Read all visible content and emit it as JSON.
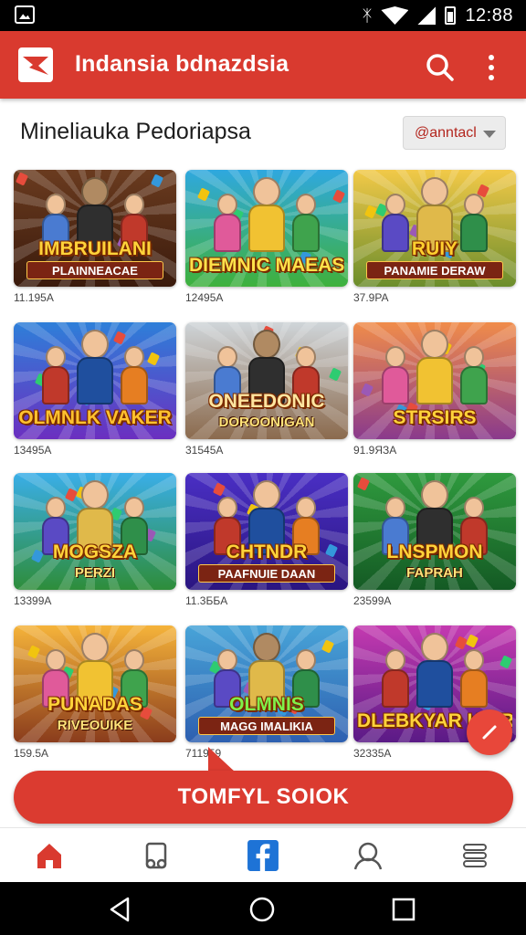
{
  "status_bar": {
    "time": "12:88"
  },
  "app_bar": {
    "title": "Indansia bdnazdsia"
  },
  "section": {
    "title": "Mineliauka Pedoriapsa",
    "sort_value": "@anntacl"
  },
  "games": [
    {
      "title": "IMBRUILANI",
      "subtitle": "PLAINNEACAE",
      "meta": "11.195A",
      "bg_top": "#6a3b1f",
      "bg_bottom": "#3a1a0c",
      "title_color": "#ffd33a"
    },
    {
      "title": "DIEMNIC MAEAS",
      "subtitle": "",
      "meta": "12495A",
      "bg_top": "#2fa8df",
      "bg_bottom": "#3fb13c",
      "title_color": "#ffe24a"
    },
    {
      "title": "RUIY",
      "subtitle": "PANAMIE DERAW",
      "meta": "37.9PA",
      "bg_top": "#f2c948",
      "bg_bottom": "#6b8d2c",
      "title_color": "#ffcf2e"
    },
    {
      "title": "OLMNLK VAKER",
      "subtitle": "",
      "meta": "13495A",
      "bg_top": "#2e7fd9",
      "bg_bottom": "#6b2fc0",
      "title_color": "#ffc22e"
    },
    {
      "title": "ONEEDONIC",
      "subtitle": "DOROONIGAN",
      "meta": "31545A",
      "bg_top": "#cfd5d9",
      "bg_bottom": "#8b6a4d",
      "title_color": "#ffe5a0"
    },
    {
      "title": "STRSIRS",
      "subtitle": "",
      "meta": "91.9ЯЗA",
      "bg_top": "#f08c4a",
      "bg_bottom": "#8a3a8c",
      "title_color": "#ffd33a"
    },
    {
      "title": "MOGSZA",
      "subtitle": "PERZI",
      "meta": "13399A",
      "bg_top": "#3aaee8",
      "bg_bottom": "#2e8d3a",
      "title_color": "#ffd33a"
    },
    {
      "title": "CHTNDR",
      "subtitle": "PAAFNUIE DAAN",
      "meta": "11.3ББA",
      "bg_top": "#4a2fc4",
      "bg_bottom": "#2a1580",
      "title_color": "#ffd33a"
    },
    {
      "title": "LNSPMON",
      "subtitle": "FAPRAH",
      "meta": "23599A",
      "bg_top": "#2f9a3e",
      "bg_bottom": "#145a24",
      "title_color": "#ffd33a"
    },
    {
      "title": "PUNADAS",
      "subtitle": "RIVEOUIKE",
      "meta": "159.5A",
      "bg_top": "#f5b33a",
      "bg_bottom": "#8a3c1c",
      "title_color": "#ffd33a"
    },
    {
      "title": "OLMNIS",
      "subtitle": "MAGG IMALIKIA",
      "meta": "711959",
      "bg_top": "#48a4d8",
      "bg_bottom": "#2d5fb0",
      "title_color": "#7ff04a"
    },
    {
      "title": "DLEBKYAR HNIRS",
      "subtitle": "",
      "meta": "32335A",
      "bg_top": "#c43ab0",
      "bg_bottom": "#5a1a86",
      "title_color": "#ffd33a"
    }
  ],
  "cta": {
    "label": "TOMFYL SOIOK"
  },
  "bottom_nav": [
    "home-icon",
    "library-icon",
    "facebook-icon",
    "profile-icon",
    "menu-lines-icon"
  ],
  "colors": {
    "primary": "#d93a2f",
    "accent": "#1e73d6"
  }
}
